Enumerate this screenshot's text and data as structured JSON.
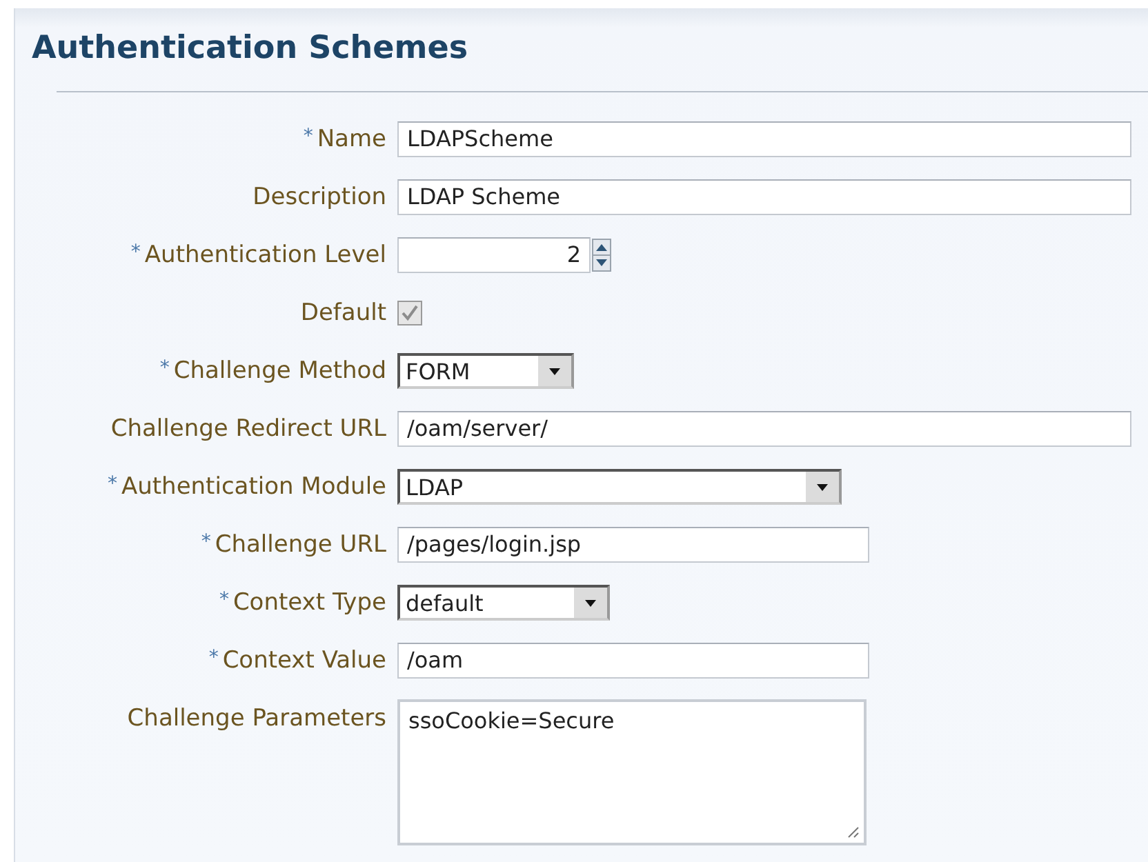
{
  "title": "Authentication Schemes",
  "required_mark": "*",
  "fields": [
    {
      "kind": "text",
      "label": "Name",
      "required": true,
      "value": "LDAPScheme"
    },
    {
      "kind": "text",
      "label": "Description",
      "required": false,
      "value": "LDAP Scheme"
    },
    {
      "kind": "spinner",
      "label": "Authentication Level",
      "required": true,
      "value": "2"
    },
    {
      "kind": "checkbox",
      "label": "Default",
      "required": false,
      "checked": true,
      "disabled": true
    },
    {
      "kind": "select",
      "label": "Challenge Method",
      "required": true,
      "value": "FORM"
    },
    {
      "kind": "text",
      "label": "Challenge Redirect URL",
      "required": false,
      "value": "/oam/server/"
    },
    {
      "kind": "select",
      "label": "Authentication Module",
      "required": true,
      "value": "LDAP"
    },
    {
      "kind": "text",
      "label": "Challenge URL",
      "required": true,
      "value": "/pages/login.jsp"
    },
    {
      "kind": "select",
      "label": "Context Type",
      "required": true,
      "value": "default"
    },
    {
      "kind": "text",
      "label": "Context Value",
      "required": true,
      "value": "/oam"
    },
    {
      "kind": "textarea",
      "label": "Challenge Parameters",
      "required": false,
      "value": "ssoCookie=Secure"
    }
  ]
}
